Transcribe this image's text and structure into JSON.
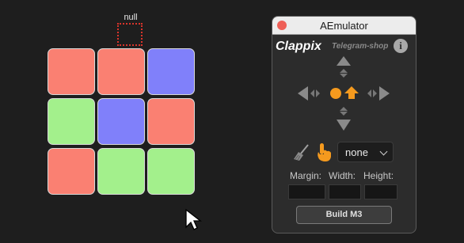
{
  "grid": {
    "null_label": "null",
    "colors": {
      "red": "#fa8072",
      "blue": "#8080fa",
      "green": "#a3f08c"
    },
    "cells": [
      [
        "red",
        "red",
        "blue"
      ],
      [
        "green",
        "blue",
        "red"
      ],
      [
        "red",
        "green",
        "green"
      ]
    ]
  },
  "panel": {
    "title": "AEmulator",
    "brand": "Clappix",
    "shop": "Telegram-shop",
    "info": "i",
    "accent": "#f59a1e",
    "icons": [
      "arrow-up-icon",
      "arrow-down-icon",
      "arrow-left-icon",
      "arrow-right-icon",
      "anchor-center-icon",
      "anchor-up-icon",
      "broom-icon",
      "hand-pointer-icon"
    ],
    "select_value": "none",
    "labels": {
      "margin": "Margin:",
      "width": "Width:",
      "height": "Height:"
    },
    "fields": {
      "margin": "",
      "width": "",
      "height": ""
    },
    "build_label": "Build M3"
  }
}
